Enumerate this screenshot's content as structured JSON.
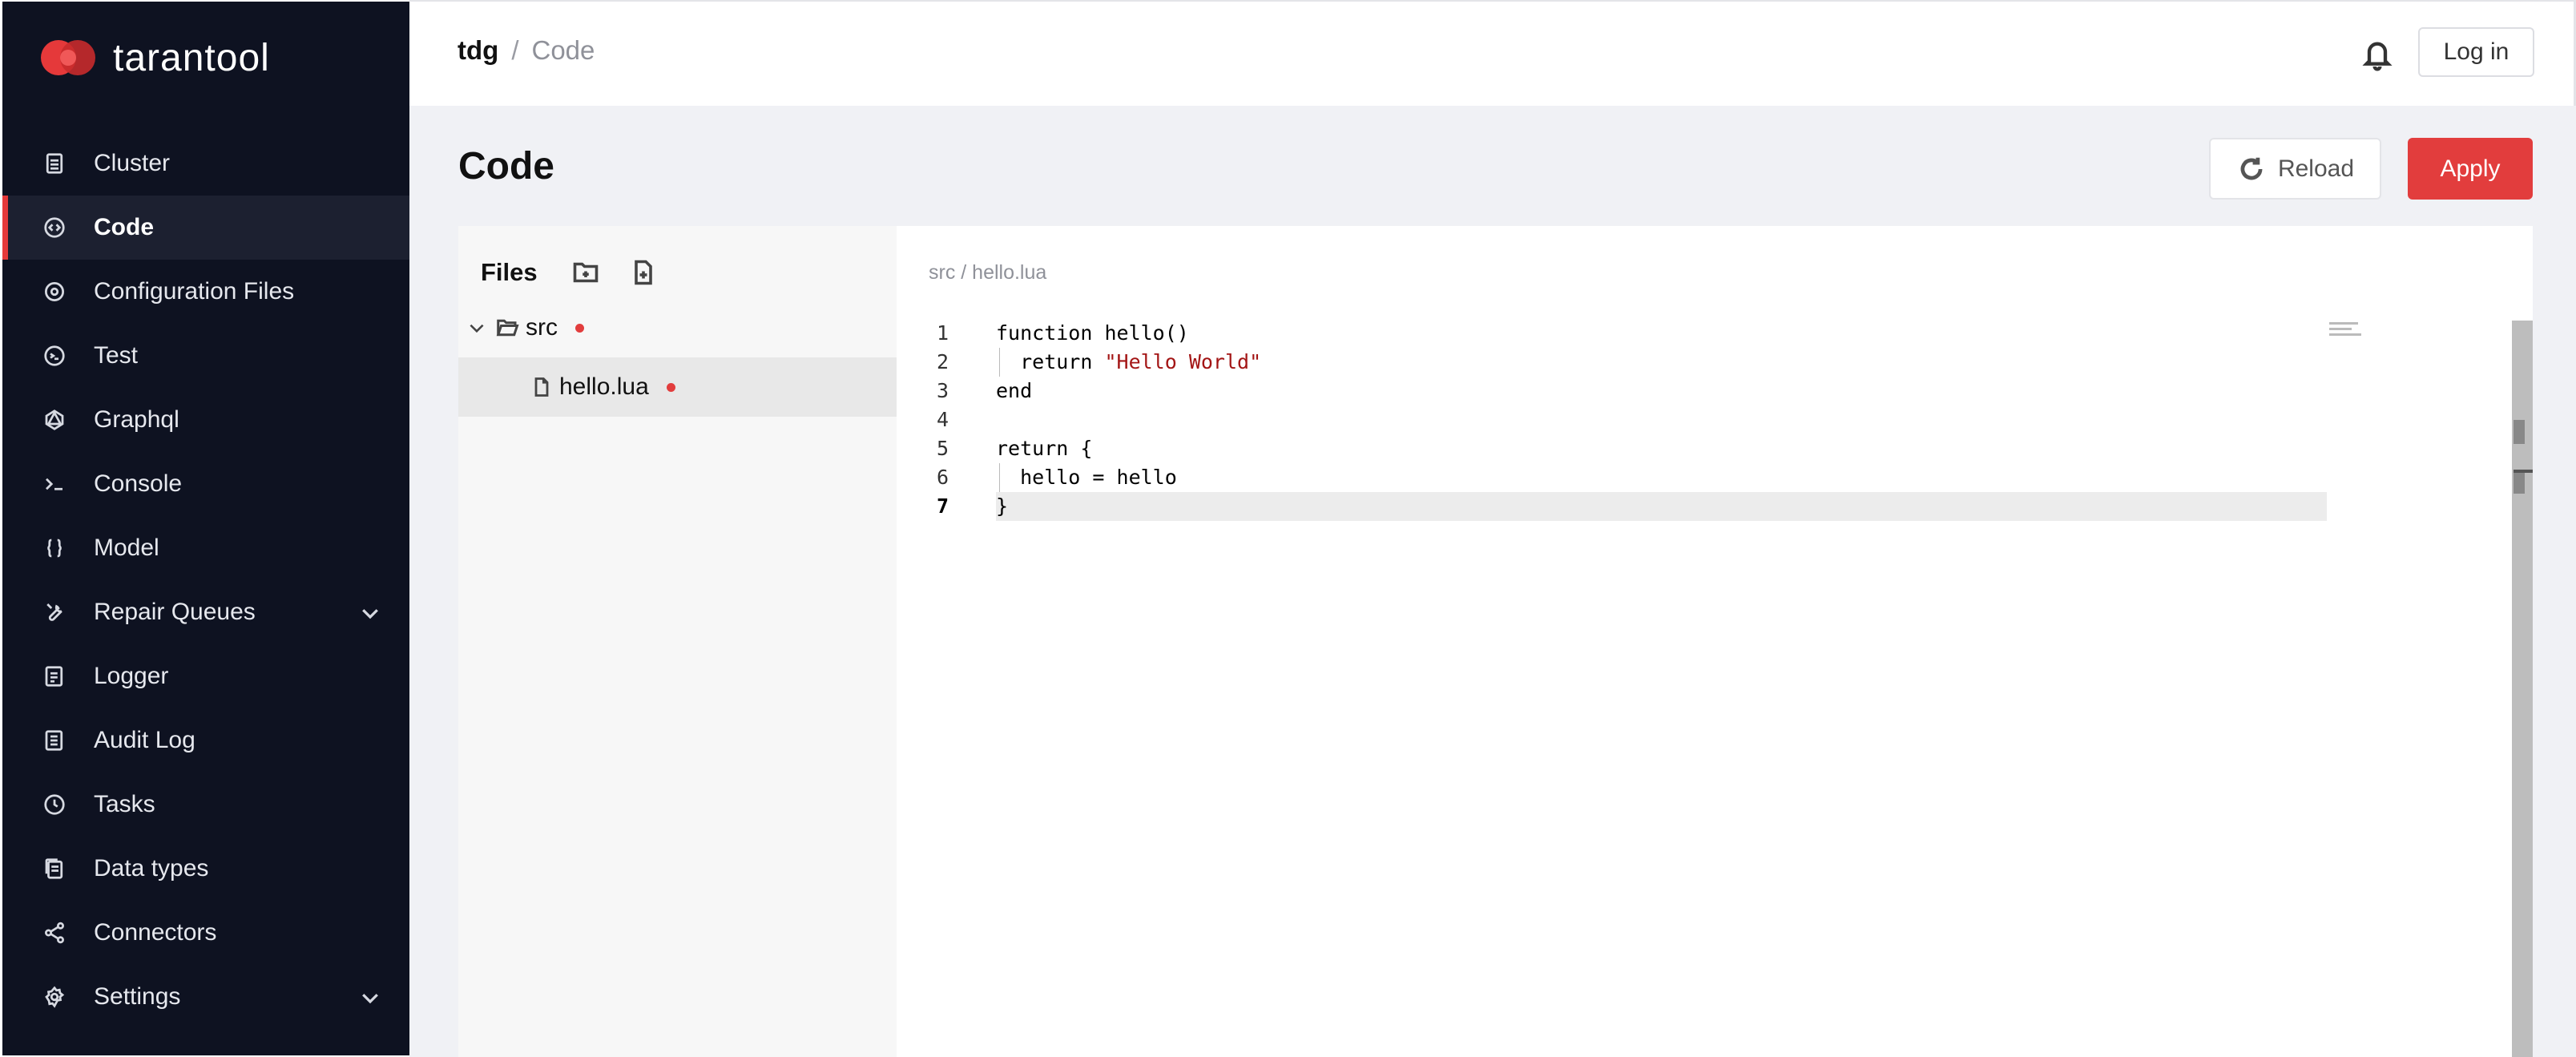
{
  "brand": {
    "name": "tarantool",
    "accent": "#e5393a",
    "sidebar_bg": "#0e1221"
  },
  "sidebar": {
    "items": [
      {
        "label": "Cluster",
        "icon": "server-icon",
        "active": false
      },
      {
        "label": "Code",
        "icon": "code-icon",
        "active": true
      },
      {
        "label": "Configuration Files",
        "icon": "gear-icon",
        "active": false
      },
      {
        "label": "Test",
        "icon": "test-icon",
        "active": false
      },
      {
        "label": "Graphql",
        "icon": "graphql-icon",
        "active": false
      },
      {
        "label": "Console",
        "icon": "terminal-icon",
        "active": false
      },
      {
        "label": "Model",
        "icon": "braces-icon",
        "active": false
      },
      {
        "label": "Repair Queues",
        "icon": "wrench-icon",
        "active": false,
        "expandable": true
      },
      {
        "label": "Logger",
        "icon": "log-icon",
        "active": false
      },
      {
        "label": "Audit Log",
        "icon": "audit-log-icon",
        "active": false
      },
      {
        "label": "Tasks",
        "icon": "clock-icon",
        "active": false
      },
      {
        "label": "Data types",
        "icon": "data-types-icon",
        "active": false
      },
      {
        "label": "Connectors",
        "icon": "share-icon",
        "active": false
      },
      {
        "label": "Settings",
        "icon": "settings-icon",
        "active": false,
        "expandable": true
      }
    ]
  },
  "header": {
    "breadcrumb_root": "tdg",
    "breadcrumb_sep": "/",
    "breadcrumb_current": "Code",
    "login_label": "Log in"
  },
  "page": {
    "title": "Code",
    "reload_label": "Reload",
    "apply_label": "Apply",
    "apply_color": "#e23d3d"
  },
  "files": {
    "title": "Files",
    "tree": [
      {
        "name": "src",
        "type": "folder",
        "expanded": true,
        "modified": true
      },
      {
        "name": "hello.lua",
        "type": "file",
        "selected": true,
        "modified": true
      }
    ]
  },
  "editor": {
    "path": "src / hello.lua",
    "lines": [
      {
        "n": "1",
        "text": "function hello()"
      },
      {
        "n": "2",
        "text": "  return \"Hello World\""
      },
      {
        "n": "3",
        "text": "end"
      },
      {
        "n": "4",
        "text": ""
      },
      {
        "n": "5",
        "text": "return {"
      },
      {
        "n": "6",
        "text": "  hello = hello"
      },
      {
        "n": "7",
        "text": "}"
      }
    ],
    "current_line": "7"
  }
}
